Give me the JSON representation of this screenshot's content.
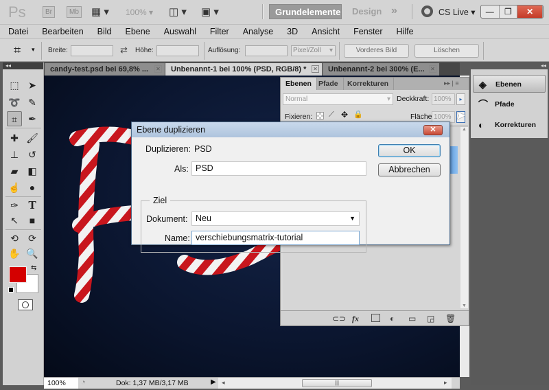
{
  "appbar": {
    "logo": "Ps",
    "bridge": "Br",
    "minibridge": "Mb",
    "zoom": "100%",
    "workspaces": [
      "Grundelemente",
      "Design"
    ],
    "more": "»",
    "cs_live": "CS Live"
  },
  "window_controls": {
    "minimize": "—",
    "restore": "❐",
    "close": "✕"
  },
  "menu": [
    "Datei",
    "Bearbeiten",
    "Bild",
    "Ebene",
    "Auswahl",
    "Filter",
    "Analyse",
    "3D",
    "Ansicht",
    "Fenster",
    "Hilfe"
  ],
  "options": {
    "width_label": "Breite:",
    "width_value": "",
    "height_label": "Höhe:",
    "height_value": "",
    "resolution_label": "Auflösung:",
    "resolution_value": "",
    "unit": "Pixel/Zoll",
    "front_image": "Vorderes Bild",
    "clear": "Löschen"
  },
  "tabs": [
    {
      "label": "candy-test.psd bei 69,8% ...",
      "active": false
    },
    {
      "label": "Unbenannt-1 bei 100% (PSD, RGB/8) *",
      "active": true
    },
    {
      "label": "Unbenannt-2 bei 300% (E...",
      "active": false
    }
  ],
  "colors": {
    "foreground": "#d40000",
    "background": "#ffffff",
    "accent": "#3c7fb1"
  },
  "status": {
    "zoom": "100%",
    "doc_size": "Dok: 1,37 MB/3,17 MB"
  },
  "layers_panel": {
    "tabs": [
      "Ebenen",
      "Pfade",
      "Korrekturen"
    ],
    "blend_mode": "Normal",
    "opacity_label": "Deckkraft:",
    "opacity": "100%",
    "lock_label": "Fixieren:",
    "fill_label": "Fläche:",
    "fill": "100%"
  },
  "dock": [
    {
      "label": "Ebenen",
      "active": true
    },
    {
      "label": "Pfade",
      "active": false
    },
    {
      "label": "Korrekturen",
      "active": false
    }
  ],
  "dialog": {
    "title": "Ebene duplizieren",
    "duplicate_label": "Duplizieren:",
    "duplicate_value": "PSD",
    "as_label": "Als:",
    "as_value": "PSD",
    "group_label": "Ziel",
    "document_label": "Dokument:",
    "document_value": "Neu",
    "name_label": "Name:",
    "name_value": "verschiebungsmatrix-tutorial",
    "ok": "OK",
    "cancel": "Abbrechen"
  }
}
